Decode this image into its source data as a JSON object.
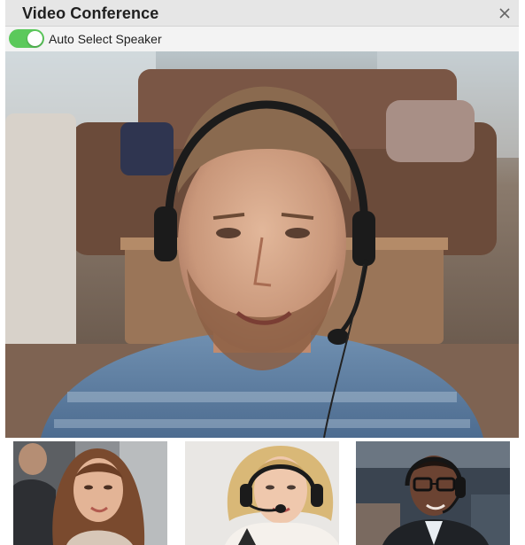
{
  "window": {
    "title": "Video Conference",
    "close_icon": "close-icon"
  },
  "toolbar": {
    "auto_select_speaker": {
      "label": "Auto Select Speaker",
      "enabled": true,
      "color": "#5bc95b"
    }
  },
  "main_video": {
    "icon": "speaker-video"
  },
  "participants": [
    {
      "icon": "participant-video"
    },
    {
      "icon": "participant-video"
    },
    {
      "icon": "participant-video"
    }
  ]
}
